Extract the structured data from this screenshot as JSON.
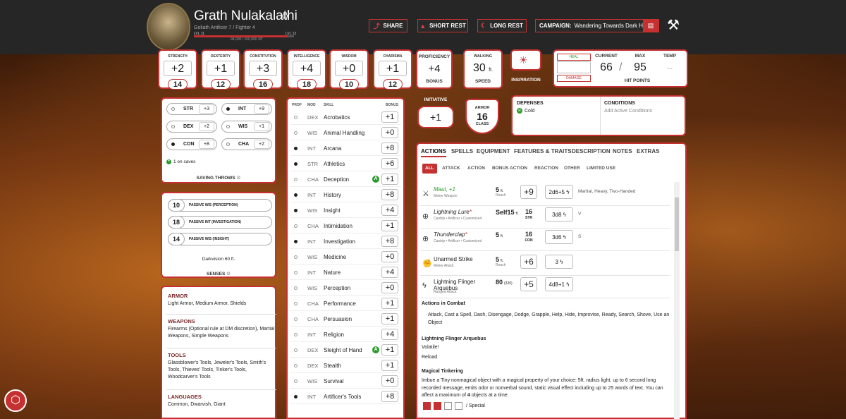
{
  "header": {
    "name": "Grath Nulakalathi",
    "subtitle": "Goliath Artificer 7 / Fighter 4",
    "lvl_left": "LVL 11",
    "lvl_right": "LVL 12",
    "xp": "94,000 / 100,000 XP",
    "xp_fraction": 0.94,
    "share": "SHARE",
    "short_rest": "SHORT REST",
    "long_rest": "LONG REST",
    "campaign_label": "CAMPAIGN:",
    "campaign": "Wandering Towards Dark H..."
  },
  "abilities": [
    {
      "label": "STRENGTH",
      "mod": "+2",
      "score": "14"
    },
    {
      "label": "DEXTERITY",
      "mod": "+1",
      "score": "12"
    },
    {
      "label": "CONSTITUTION",
      "mod": "+3",
      "score": "16"
    },
    {
      "label": "INTELLIGENCE",
      "mod": "+4",
      "score": "18"
    },
    {
      "label": "WISDOM",
      "mod": "+0",
      "score": "10"
    },
    {
      "label": "CHARISMA",
      "mod": "+1",
      "score": "12"
    }
  ],
  "proficiency": {
    "label": "PROFICIENCY",
    "value": "+4",
    "sub": "BONUS"
  },
  "speed": {
    "label": "WALKING",
    "value": "30",
    "unit": "ft.",
    "sub": "SPEED"
  },
  "inspiration": {
    "label": "INSPIRATION"
  },
  "hp": {
    "heal": "HEAL",
    "damage": "DAMAGE",
    "current_label": "CURRENT",
    "max_label": "MAX",
    "temp_label": "TEMP",
    "current": "66",
    "max": "95",
    "temp": "--",
    "title": "HIT POINTS",
    "sep": "/"
  },
  "initiative": {
    "label": "INITIATIVE",
    "value": "+1"
  },
  "armor": {
    "label": "ARMOR",
    "value": "16",
    "sub": "CLASS"
  },
  "defenses": {
    "title": "DEFENSES",
    "item": "Cold",
    "badge": "R"
  },
  "conditions": {
    "title": "CONDITIONS",
    "placeholder": "Add Active Conditions"
  },
  "saves": {
    "title": "SAVING THROWS",
    "note": "1 on saves",
    "items": [
      {
        "abbr": "STR",
        "val": "+3",
        "prof": false
      },
      {
        "abbr": "INT",
        "val": "+9",
        "prof": true
      },
      {
        "abbr": "DEX",
        "val": "+2",
        "prof": false
      },
      {
        "abbr": "WIS",
        "val": "+1",
        "prof": false
      },
      {
        "abbr": "CON",
        "val": "+8",
        "prof": true
      },
      {
        "abbr": "CHA",
        "val": "+2",
        "prof": false
      }
    ]
  },
  "senses": {
    "title": "SENSES",
    "darkvision": "Darkvision 60 ft.",
    "items": [
      {
        "n": "10",
        "label": "PASSIVE WIS (PERCEPTION)"
      },
      {
        "n": "18",
        "label": "PASSIVE INT (INVESTIGATION)"
      },
      {
        "n": "14",
        "label": "PASSIVE WIS (INSIGHT)"
      }
    ]
  },
  "proficiencies": {
    "armor_h": "ARMOR",
    "armor": "Light Armor, Medium Armor, Shields",
    "weapons_h": "WEAPONS",
    "weapons": "Firearms (Optional rule at DM discretion), Martial Weapons, Simple Weapons",
    "tools_h": "TOOLS",
    "tools": "Glassblower's Tools, Jeweler's Tools, Smith's Tools, Thieves' Tools, Tinker's Tools, Woodcarver's Tools",
    "lang_h": "LANGUAGES",
    "lang": "Common, Dwarvish, Giant"
  },
  "skills": {
    "h_prof": "PROF",
    "h_mod": "MOD",
    "h_skill": "SKILL",
    "h_bonus": "BONUS",
    "items": [
      {
        "m": "DEX",
        "s": "Acrobatics",
        "b": "+1",
        "p": false,
        "a": false
      },
      {
        "m": "WIS",
        "s": "Animal Handling",
        "b": "+0",
        "p": false,
        "a": false
      },
      {
        "m": "INT",
        "s": "Arcana",
        "b": "+8",
        "p": true,
        "a": false
      },
      {
        "m": "STR",
        "s": "Athletics",
        "b": "+6",
        "p": true,
        "a": false
      },
      {
        "m": "CHA",
        "s": "Deception",
        "b": "+1",
        "p": false,
        "a": true
      },
      {
        "m": "INT",
        "s": "History",
        "b": "+8",
        "p": true,
        "a": false
      },
      {
        "m": "WIS",
        "s": "Insight",
        "b": "+4",
        "p": true,
        "a": false
      },
      {
        "m": "CHA",
        "s": "Intimidation",
        "b": "+1",
        "p": false,
        "a": false
      },
      {
        "m": "INT",
        "s": "Investigation",
        "b": "+8",
        "p": true,
        "a": false
      },
      {
        "m": "WIS",
        "s": "Medicine",
        "b": "+0",
        "p": false,
        "a": false
      },
      {
        "m": "INT",
        "s": "Nature",
        "b": "+4",
        "p": false,
        "a": false
      },
      {
        "m": "WIS",
        "s": "Perception",
        "b": "+0",
        "p": false,
        "a": false
      },
      {
        "m": "CHA",
        "s": "Performance",
        "b": "+1",
        "p": false,
        "a": false
      },
      {
        "m": "CHA",
        "s": "Persuasion",
        "b": "+1",
        "p": false,
        "a": false
      },
      {
        "m": "INT",
        "s": "Religion",
        "b": "+4",
        "p": false,
        "a": false
      },
      {
        "m": "DEX",
        "s": "Sleight of Hand",
        "b": "+1",
        "p": false,
        "a": true
      },
      {
        "m": "DEX",
        "s": "Stealth",
        "b": "+1",
        "p": false,
        "a": false
      },
      {
        "m": "WIS",
        "s": "Survival",
        "b": "+0",
        "p": false,
        "a": false
      },
      {
        "m": "INT",
        "s": "Artificer's Tools",
        "b": "+8",
        "p": true,
        "a": false
      }
    ]
  },
  "adv_badge": "A",
  "tabs": [
    "ACTIONS",
    "SPELLS",
    "EQUIPMENT",
    "FEATURES & TRAITS",
    "DESCRIPTION",
    "NOTES",
    "EXTRAS"
  ],
  "filters": [
    "ALL",
    "ATTACK",
    "ACTION",
    "BONUS ACTION",
    "REACTION",
    "OTHER",
    "LIMITED USE"
  ],
  "actions": [
    {
      "name": "Maul, +1",
      "sub": "Melee Weapon",
      "range": "5",
      "range_unit": "ft.",
      "range_sub": "Reach",
      "hit": "+9",
      "dmg": "2d6+5",
      "notes": "Martial, Heavy, Two-Handed",
      "italic": true,
      "icon": "crossed-swords-icon"
    },
    {
      "name": "Lightning Lure",
      "mark": "*",
      "sub": "Cantrip • Artificer • Customized",
      "range": "Self15",
      "range_unit": "ft.",
      "dc": "16",
      "dc_sub": "STR",
      "dmg": "3d8",
      "notes": "V",
      "italic": true,
      "icon": "spell-icon"
    },
    {
      "name": "Thunderclap",
      "mark": "*",
      "sub": "Cantrip • Artificer • Customized",
      "range": "5",
      "range_unit": "ft.",
      "dc": "16",
      "dc_sub": "CON",
      "dmg": "3d6",
      "notes": "S",
      "italic": true,
      "icon": "spell-icon"
    },
    {
      "name": "Unarmed Strike",
      "sub": "Melee Attack",
      "range": "5",
      "range_unit": "ft.",
      "range_sub": "Reach",
      "hit": "+6",
      "dmg": "3",
      "notes": "",
      "italic": false,
      "icon": "fist-icon"
    },
    {
      "name": "Lightning Flinger Arquebus",
      "sub": "Ranged Attack",
      "range": "80",
      "range_unit": "(320)",
      "hit": "+5",
      "dmg": "4d8+1",
      "notes": "",
      "italic": false,
      "icon": "lightning-icon"
    }
  ],
  "combat": {
    "title": "Actions in Combat",
    "text": "Attack, Cast a Spell, Dash, Disengage, Dodge, Grapple, Help, Hide, Improvise, Ready, Search, Shove, Use an Object"
  },
  "arquebus": {
    "title": "Lightning Flinger Arquebus",
    "l1": "Volatile!",
    "l2": "Reload"
  },
  "tinkering": {
    "title": "Magical Tinkering",
    "text": "Imbue a Tiny nonmagical object with a magical property of your choice: 5ft. radius light, up to 6 second long recorded message, emits odor or nonverbal sound, static visual effect including up to 25 words of text. You can affect a maximum of",
    "count": "4",
    "text2": "objects at a time.",
    "slots_used": 2,
    "slots_total": 4,
    "special": "/ Special"
  },
  "colors": {
    "accent": "#c53131",
    "topbar": "#262626"
  }
}
